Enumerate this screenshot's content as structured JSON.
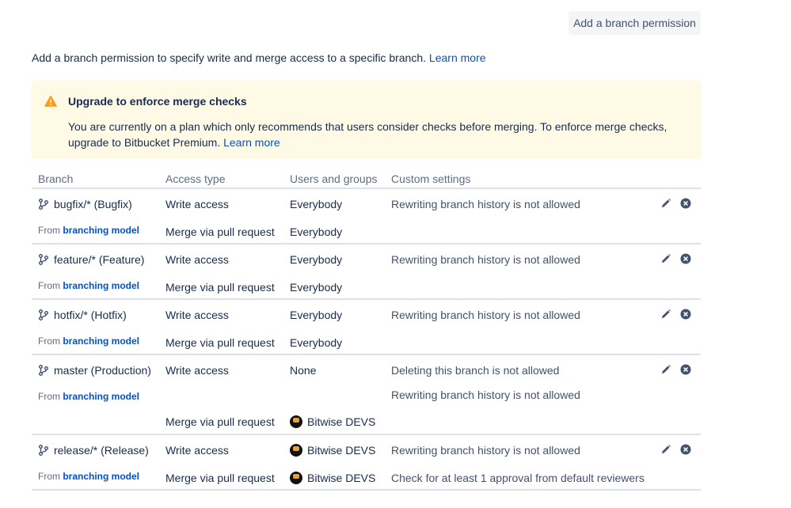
{
  "header": {
    "add_button": "Add a branch permission"
  },
  "intro": {
    "text": "Add a branch permission to specify write and merge access to a specific branch. ",
    "link": "Learn more"
  },
  "banner": {
    "title": "Upgrade to enforce merge checks",
    "body": "You are currently on a plan which only recommends that users consider checks before merging. To enforce merge checks, upgrade to Bitbucket Premium. ",
    "link": "Learn more",
    "color": "#fffae6"
  },
  "columns": {
    "branch": "Branch",
    "access": "Access type",
    "users": "Users and groups",
    "custom": "Custom settings"
  },
  "from_label": "From",
  "from_link": "branching model",
  "rows": [
    {
      "branch": "bugfix/* (Bugfix)",
      "access_write": "Write access",
      "users_write": "Everybody",
      "setting_1": "Rewriting branch history is not allowed",
      "access_merge": "Merge via pull request",
      "users_merge": "Everybody"
    },
    {
      "branch": "feature/* (Feature)",
      "access_write": "Write access",
      "users_write": "Everybody",
      "setting_1": "Rewriting branch history is not allowed",
      "access_merge": "Merge via pull request",
      "users_merge": "Everybody"
    },
    {
      "branch": "hotfix/* (Hotfix)",
      "access_write": "Write access",
      "users_write": "Everybody",
      "setting_1": "Rewriting branch history is not allowed",
      "access_merge": "Merge via pull request",
      "users_merge": "Everybody"
    },
    {
      "branch": "master (Production)",
      "access_write": "Write access",
      "users_write": "None",
      "setting_1": "Deleting this branch is not allowed",
      "setting_2": "Rewriting branch history is not allowed",
      "access_merge": "Merge via pull request",
      "users_merge": "Bitwise DEVS"
    },
    {
      "branch": "release/* (Release)",
      "access_write": "Write access",
      "users_write": "Bitwise DEVS",
      "setting_1": "Rewriting branch history is not allowed",
      "access_merge": "Merge via pull request",
      "users_merge": "Bitwise DEVS",
      "setting_2": "Check for at least 1 approval from default reviewers"
    }
  ]
}
